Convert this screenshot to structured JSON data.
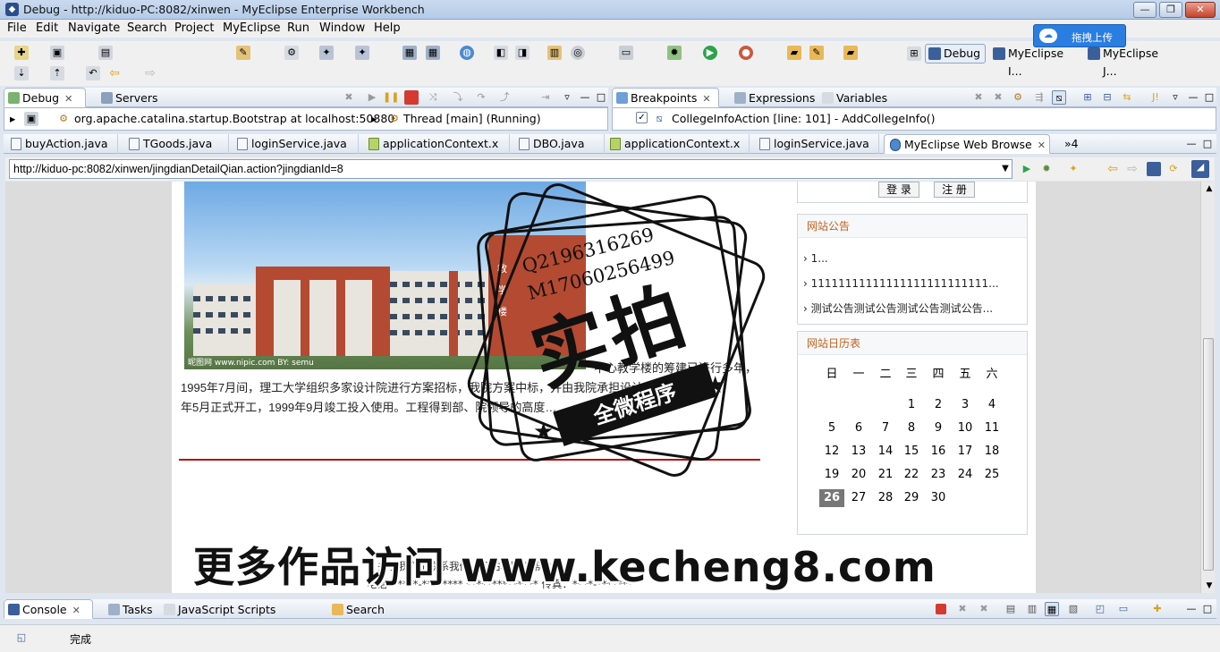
{
  "window": {
    "title": "Debug - http://kiduo-PC:8082/xinwen - MyEclipse Enterprise Workbench"
  },
  "menu": [
    "File",
    "Edit",
    "Navigate",
    "Search",
    "Project",
    "MyEclipse",
    "Run",
    "Window",
    "Help"
  ],
  "upload_badge": "拖拽上传",
  "perspectives": [
    "Debug",
    "MyEclipse I...",
    "MyEclipse J..."
  ],
  "debug_views": {
    "tabs": [
      "Debug",
      "Servers"
    ],
    "process": "org.apache.catalina.startup.Bootstrap at localhost:50880",
    "thread": "Thread [main] (Running)"
  },
  "breakpoint_views": {
    "tabs": [
      "Breakpoints",
      "Expressions",
      "Variables"
    ],
    "entry": "CollegeInfoAction [line: 101] - AddCollegeInfo()"
  },
  "editor_tabs": [
    "buyAction.java",
    "TGoods.java",
    "loginService.java",
    "applicationContext.x",
    "DBO.java",
    "applicationContext.x",
    "loginService.java",
    "MyEclipse Web Browse",
    "»4"
  ],
  "browser": {
    "url": "http://kiduo-pc:8082/xinwen/jingdianDetailQian.action?jingdianId=8",
    "photo_watermark": "昵图网 www.nipic.com  BY: semu",
    "building_sign": [
      "教",
      "学",
      "楼"
    ],
    "article_lines": [
      "中心教学楼的筹建已进行多年，",
      "1995年7月间，理工大学组织多家设计院进行方案招标，我院方案中标，并由我院承担设计任务，1997",
      "年5月正式开工，1999年9月竣工投入使用。工程得到部、院领导的高度…"
    ],
    "login_buttons": [
      "登 录",
      "注 册"
    ],
    "notice": {
      "title": "网站公告",
      "items": [
        "1...",
        "11111111111111111111111111...",
        "测试公告测试公告测试公告测试公告..."
      ]
    },
    "calendar": {
      "title": "网站日历表",
      "weekdays": [
        "日",
        "一",
        "二",
        "三",
        "四",
        "五",
        "六"
      ],
      "weeks": [
        [
          "",
          "",
          "",
          "1",
          "2",
          "3",
          "4"
        ],
        [
          "5",
          "6",
          "7",
          "8",
          "9",
          "10",
          "11"
        ],
        [
          "12",
          "13",
          "14",
          "15",
          "16",
          "17",
          "18"
        ],
        [
          "19",
          "20",
          "21",
          "22",
          "23",
          "24",
          "25"
        ],
        [
          "26",
          "27",
          "28",
          "29",
          "30",
          "",
          ""
        ]
      ],
      "today": "26"
    },
    "footer": {
      "links": "关于我们 | 联系我们 | 网站地图 | 帮助",
      "contact": "电话：****-******** ************** 传真：****-*******"
    }
  },
  "bottom_tabs": [
    "Console",
    "Tasks",
    "JavaScript Scripts Inspector",
    "Search"
  ],
  "status": "完成",
  "stamp": {
    "big": "实拍",
    "ribbon": "全微程序",
    "phones": [
      "Q2196316269",
      "M17060256499"
    ]
  },
  "promo_text": "更多作品访问 www.kecheng8.com"
}
